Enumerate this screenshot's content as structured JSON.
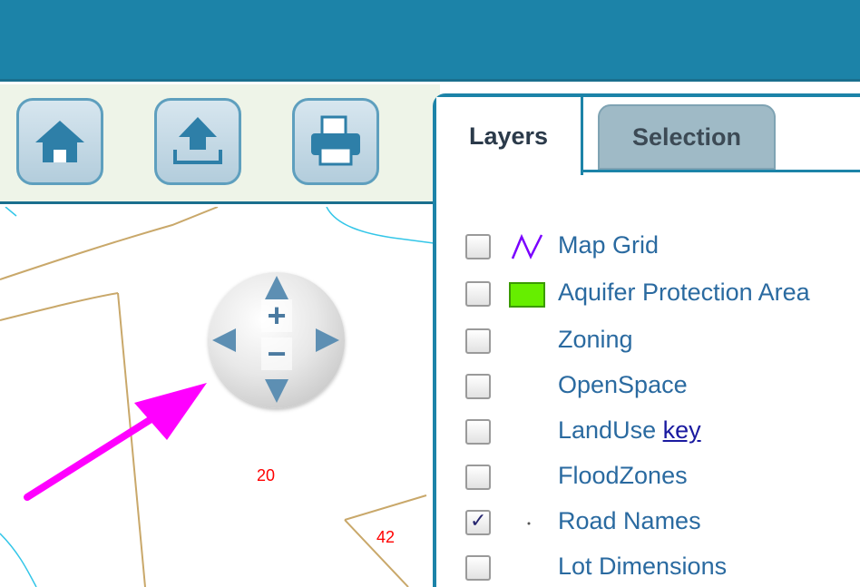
{
  "toolbar": {
    "buttons": [
      {
        "name": "home",
        "icon": "home-icon"
      },
      {
        "name": "upload",
        "icon": "upload-icon"
      },
      {
        "name": "print",
        "icon": "printer-icon"
      }
    ]
  },
  "map": {
    "lot_numbers": [
      "20",
      "42"
    ],
    "pan_zoom": {
      "zoom_in_label": "+",
      "zoom_out_label": "−"
    },
    "annotation_arrow_color": "#ff00ff"
  },
  "panel": {
    "tabs": [
      {
        "label": "Layers",
        "active": true
      },
      {
        "label": "Selection",
        "active": false
      }
    ],
    "layers": [
      {
        "label": "Map Grid",
        "checked": false,
        "legend": "zigzag-line",
        "legend_color": "#7a00ff"
      },
      {
        "label": "Aquifer Protection Area",
        "checked": false,
        "legend": "filled-box",
        "legend_color": "#66ee00"
      },
      {
        "label": "Zoning",
        "checked": false,
        "legend": "none"
      },
      {
        "label": "OpenSpace",
        "checked": false,
        "legend": "none"
      },
      {
        "label": "LandUse",
        "checked": false,
        "legend": "none",
        "key_link": "key"
      },
      {
        "label": "FloodZones",
        "checked": false,
        "legend": "none"
      },
      {
        "label": "Road Names",
        "checked": true,
        "legend": "dot"
      },
      {
        "label": "Lot Dimensions",
        "checked": false,
        "legend": "none"
      }
    ]
  },
  "colors": {
    "header": "#1c83a8",
    "toolbar_bg": "#eef4e8",
    "layer_label": "#2a6aa0",
    "lot_number": "#ff0000"
  }
}
